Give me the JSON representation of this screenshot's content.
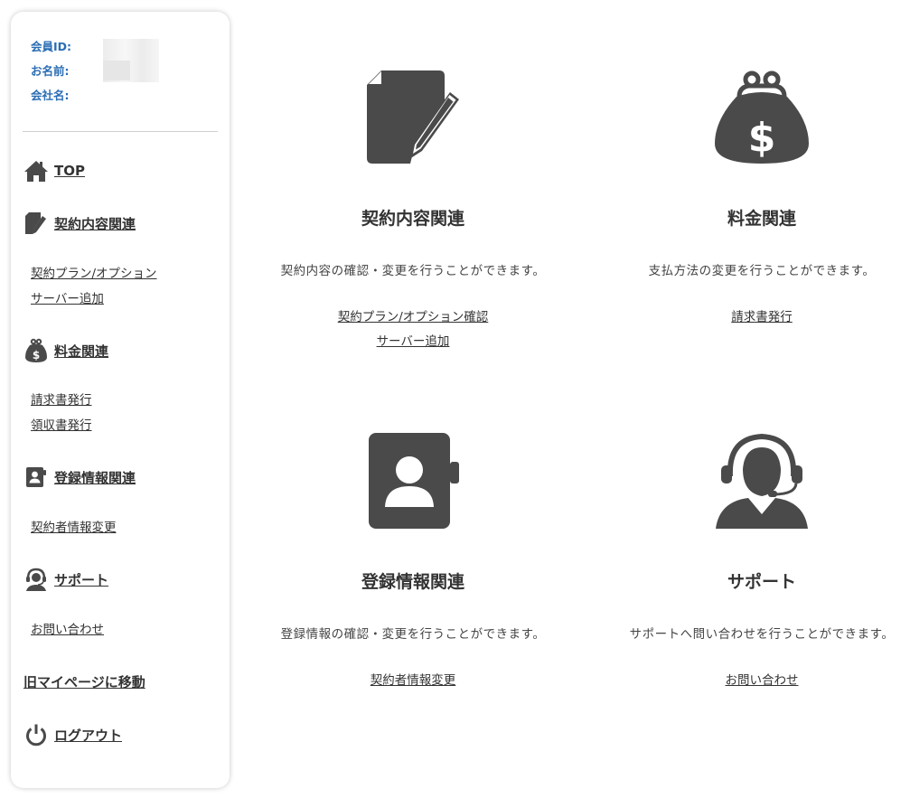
{
  "member": {
    "id_label": "会員ID:",
    "name_label": "お名前:",
    "company_label": "会社名:"
  },
  "nav": {
    "top": "TOP",
    "contract": {
      "label": "契約内容関連",
      "items": [
        "契約プラン/オプション",
        "サーバー追加"
      ]
    },
    "billing": {
      "label": "料金関連",
      "items": [
        "請求書発行",
        "領収書発行"
      ]
    },
    "registration": {
      "label": "登録情報関連",
      "items": [
        "契約者情報変更"
      ]
    },
    "support": {
      "label": "サポート",
      "items": [
        "お問い合わせ"
      ]
    },
    "old_mypage": "旧マイページに移動",
    "logout": "ログアウト"
  },
  "cards": {
    "contract": {
      "title": "契約内容関連",
      "desc": "契約内容の確認・変更を行うことができます。",
      "links": [
        "契約プラン/オプション確認",
        "サーバー追加"
      ]
    },
    "billing": {
      "title": "料金関連",
      "desc": "支払方法の変更を行うことができます。",
      "links": [
        "請求書発行"
      ]
    },
    "registration": {
      "title": "登録情報関連",
      "desc": "登録情報の確認・変更を行うことができます。",
      "links": [
        "契約者情報変更"
      ]
    },
    "support": {
      "title": "サポート",
      "desc": "サポートへ問い合わせを行うことができます。",
      "links": [
        "お問い合わせ"
      ]
    }
  },
  "icons": {
    "home": "home-icon",
    "contract": "document-pencil-icon",
    "billing": "purse-dollar-icon",
    "registration": "contact-book-icon",
    "support": "operator-headset-icon",
    "logout": "power-icon"
  },
  "colors": {
    "icon": "#4a4a4a",
    "member_label": "#2a6db4"
  }
}
